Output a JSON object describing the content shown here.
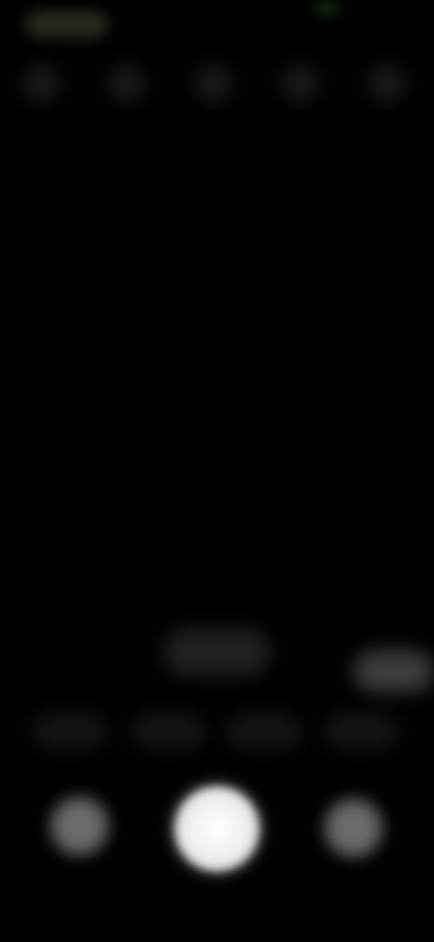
{
  "colors": {
    "background": "#000000",
    "status_indicator": "#2d5a2d",
    "shutter": "#ffffff",
    "secondary_button": "#b9b9b9",
    "mode_chip": "#262626"
  },
  "icons": {
    "top_controls": [
      "camera-setting-icon",
      "camera-setting-icon",
      "camera-setting-icon",
      "camera-setting-icon",
      "camera-setting-icon"
    ],
    "gallery": "gallery-icon",
    "shutter": "shutter-icon",
    "switch_camera": "switch-camera-icon"
  }
}
